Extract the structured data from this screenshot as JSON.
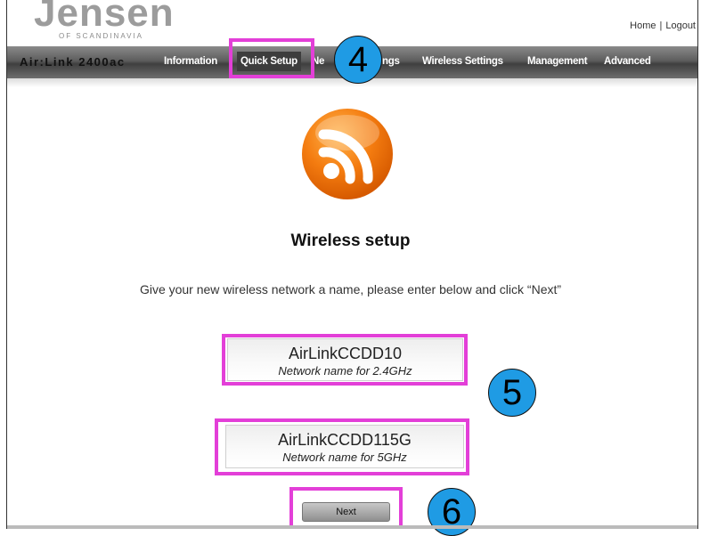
{
  "header": {
    "logo_text": "Jensen",
    "logo_subtext": "OF SCANDINAVIA",
    "home_link": "Home",
    "separator": "|",
    "logout_link": "Logout"
  },
  "nav": {
    "brand": "Air:Link 2400ac",
    "items": [
      {
        "label": "Information"
      },
      {
        "label": "Quick Setup",
        "active": true
      },
      {
        "label": "Ne"
      },
      {
        "label": "ngs"
      },
      {
        "label": "Wireless Settings"
      },
      {
        "label": "Management"
      },
      {
        "label": "Advanced"
      }
    ]
  },
  "main": {
    "icon": "rss-wifi-icon",
    "title": "Wireless setup",
    "instructions": "Give your new wireless network a name, please enter below and click “Next”",
    "fields": [
      {
        "value": "AirLinkCCDD10",
        "caption": "Network name for 2.4GHz"
      },
      {
        "value": "AirLinkCCDD115G",
        "caption": "Network name for 5GHz"
      }
    ],
    "next_button": "Next"
  },
  "annotations": {
    "badge_4": "4",
    "badge_5": "5",
    "badge_6": "6",
    "highlight_color": "#e33fd8",
    "badge_color": "#1f9be4"
  },
  "colors": {
    "icon_orange": "#f07a12",
    "nav_dark": "#4a4a4a"
  }
}
